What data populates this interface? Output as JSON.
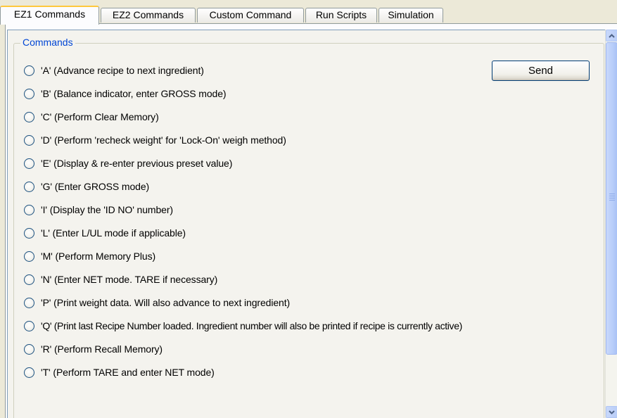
{
  "tabs": [
    {
      "label": "EZ1 Commands",
      "active": true
    },
    {
      "label": "EZ2 Commands",
      "active": false
    },
    {
      "label": "Custom Command",
      "active": false
    },
    {
      "label": "Run Scripts",
      "active": false
    },
    {
      "label": "Simulation",
      "active": false
    }
  ],
  "group": {
    "title": "Commands"
  },
  "send_button": {
    "label": "Send"
  },
  "commands": [
    {
      "label": "'A' (Advance recipe to next ingredient)",
      "selected": false
    },
    {
      "label": "'B' (Balance indicator, enter GROSS mode)",
      "selected": false
    },
    {
      "label": "'C' (Perform Clear Memory)",
      "selected": false
    },
    {
      "label": "'D' (Perform 'recheck weight' for 'Lock-On' weigh method)",
      "selected": false
    },
    {
      "label": "'E' (Display & re-enter previous preset value)",
      "selected": false
    },
    {
      "label": "'G' (Enter GROSS mode)",
      "selected": false
    },
    {
      "label": "'I' (Display the 'ID NO' number)",
      "selected": false
    },
    {
      "label": "'L' (Enter L/UL mode if applicable)",
      "selected": false
    },
    {
      "label": "'M' (Perform Memory Plus)",
      "selected": false
    },
    {
      "label": "'N' (Enter NET mode.  TARE if necessary)",
      "selected": false
    },
    {
      "label": "'P' (Print weight data.  Will also advance to next ingredient)",
      "selected": false
    },
    {
      "label": "'Q' (Print last Recipe Number loaded.  Ingredient number will also be printed if recipe is currently active)",
      "selected": false
    },
    {
      "label": "'R' (Perform Recall Memory)",
      "selected": false
    },
    {
      "label": "'T' (Perform TARE and enter NET mode)",
      "selected": false
    }
  ],
  "colors": {
    "group_title": "#0046d5",
    "active_tab_accent": "#ffc83c",
    "scrollbar": "#b9cdf7"
  }
}
